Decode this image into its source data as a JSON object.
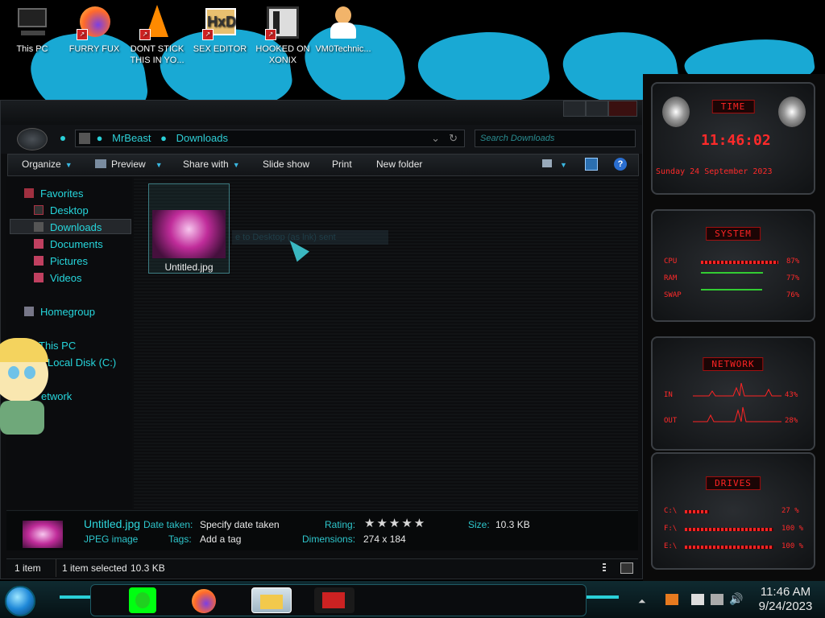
{
  "desktop": {
    "icons": [
      {
        "label": "This PC",
        "icon": "computer-icon"
      },
      {
        "label": "FURRY FUX",
        "icon": "firefox-icon"
      },
      {
        "label": "DONT STICK THIS IN YO...",
        "icon": "vlc-icon"
      },
      {
        "label": "SEX EDITOR",
        "icon": "hxd-icon"
      },
      {
        "label": "HOOKED ON XONIX",
        "icon": "xonix-icon"
      },
      {
        "label": "VM0Technic...",
        "icon": "person-icon"
      }
    ]
  },
  "explorer": {
    "address": {
      "root": "MrBeast",
      "folder": "Downloads"
    },
    "search_placeholder": "Search Downloads",
    "toolbar": {
      "organize": "Organize",
      "preview": "Preview",
      "share_with": "Share with",
      "slide_show": "Slide show",
      "print": "Print",
      "new_folder": "New folder"
    },
    "nav": {
      "favorites": "Favorites",
      "desktop": "Desktop",
      "downloads": "Downloads",
      "documents": "Documents",
      "pictures": "Pictures",
      "videos": "Videos",
      "homegroup": "Homegroup",
      "this_pc": "This PC",
      "local_disk": "Local Disk (C:)",
      "network": "etwork"
    },
    "file": {
      "name": "Untitled.jpg"
    },
    "drag_tooltip": "e to Desktop (as lnk) sent",
    "details": {
      "filename": "Untitled.jpg",
      "filetype": "JPEG image",
      "date_taken_label": "Date taken:",
      "date_taken_value": "Specify date taken",
      "tags_label": "Tags:",
      "tags_value": "Add a tag",
      "rating_label": "Rating:",
      "rating_stars": "★★★★★",
      "rating_value": 0,
      "dimensions_label": "Dimensions:",
      "dimensions_value": "274 x 184",
      "size_label": "Size:",
      "size_value": "10.3 KB"
    },
    "status": {
      "items": "1 item",
      "selected": "1 item selected",
      "selected_size": "10.3 KB"
    }
  },
  "gadgets": {
    "time": {
      "title": "TIME",
      "clock": "11:46:02",
      "date": "Sunday 24 September 2023"
    },
    "system": {
      "title": "SYSTEM",
      "cpu_label": "CPU",
      "cpu_value": "87%",
      "cpu_level": 0.87,
      "ram_label": "RAM",
      "ram_value": "77%",
      "ram_level": 0.77,
      "swap_label": "SWAP",
      "swap_value": "76%",
      "swap_level": 0.76
    },
    "network": {
      "title": "NETWORK",
      "in_label": "IN",
      "in_value": "43%",
      "out_label": "OUT",
      "out_value": "28%"
    },
    "drives": {
      "title": "DRIVES",
      "items": [
        {
          "label": "C:\\",
          "value": "27 %",
          "level": 0.27
        },
        {
          "label": "F:\\",
          "value": "100 %",
          "level": 1.0
        },
        {
          "label": "E:\\",
          "value": "100 %",
          "level": 1.0
        }
      ]
    }
  },
  "taskbar": {
    "clock_time": "11:46 AM",
    "clock_date": "9/24/2023",
    "colors": {
      "accent": "#2ad0d8",
      "gadget_red": "#ff2424",
      "wallpaper_blue": "#19a9d4"
    }
  }
}
